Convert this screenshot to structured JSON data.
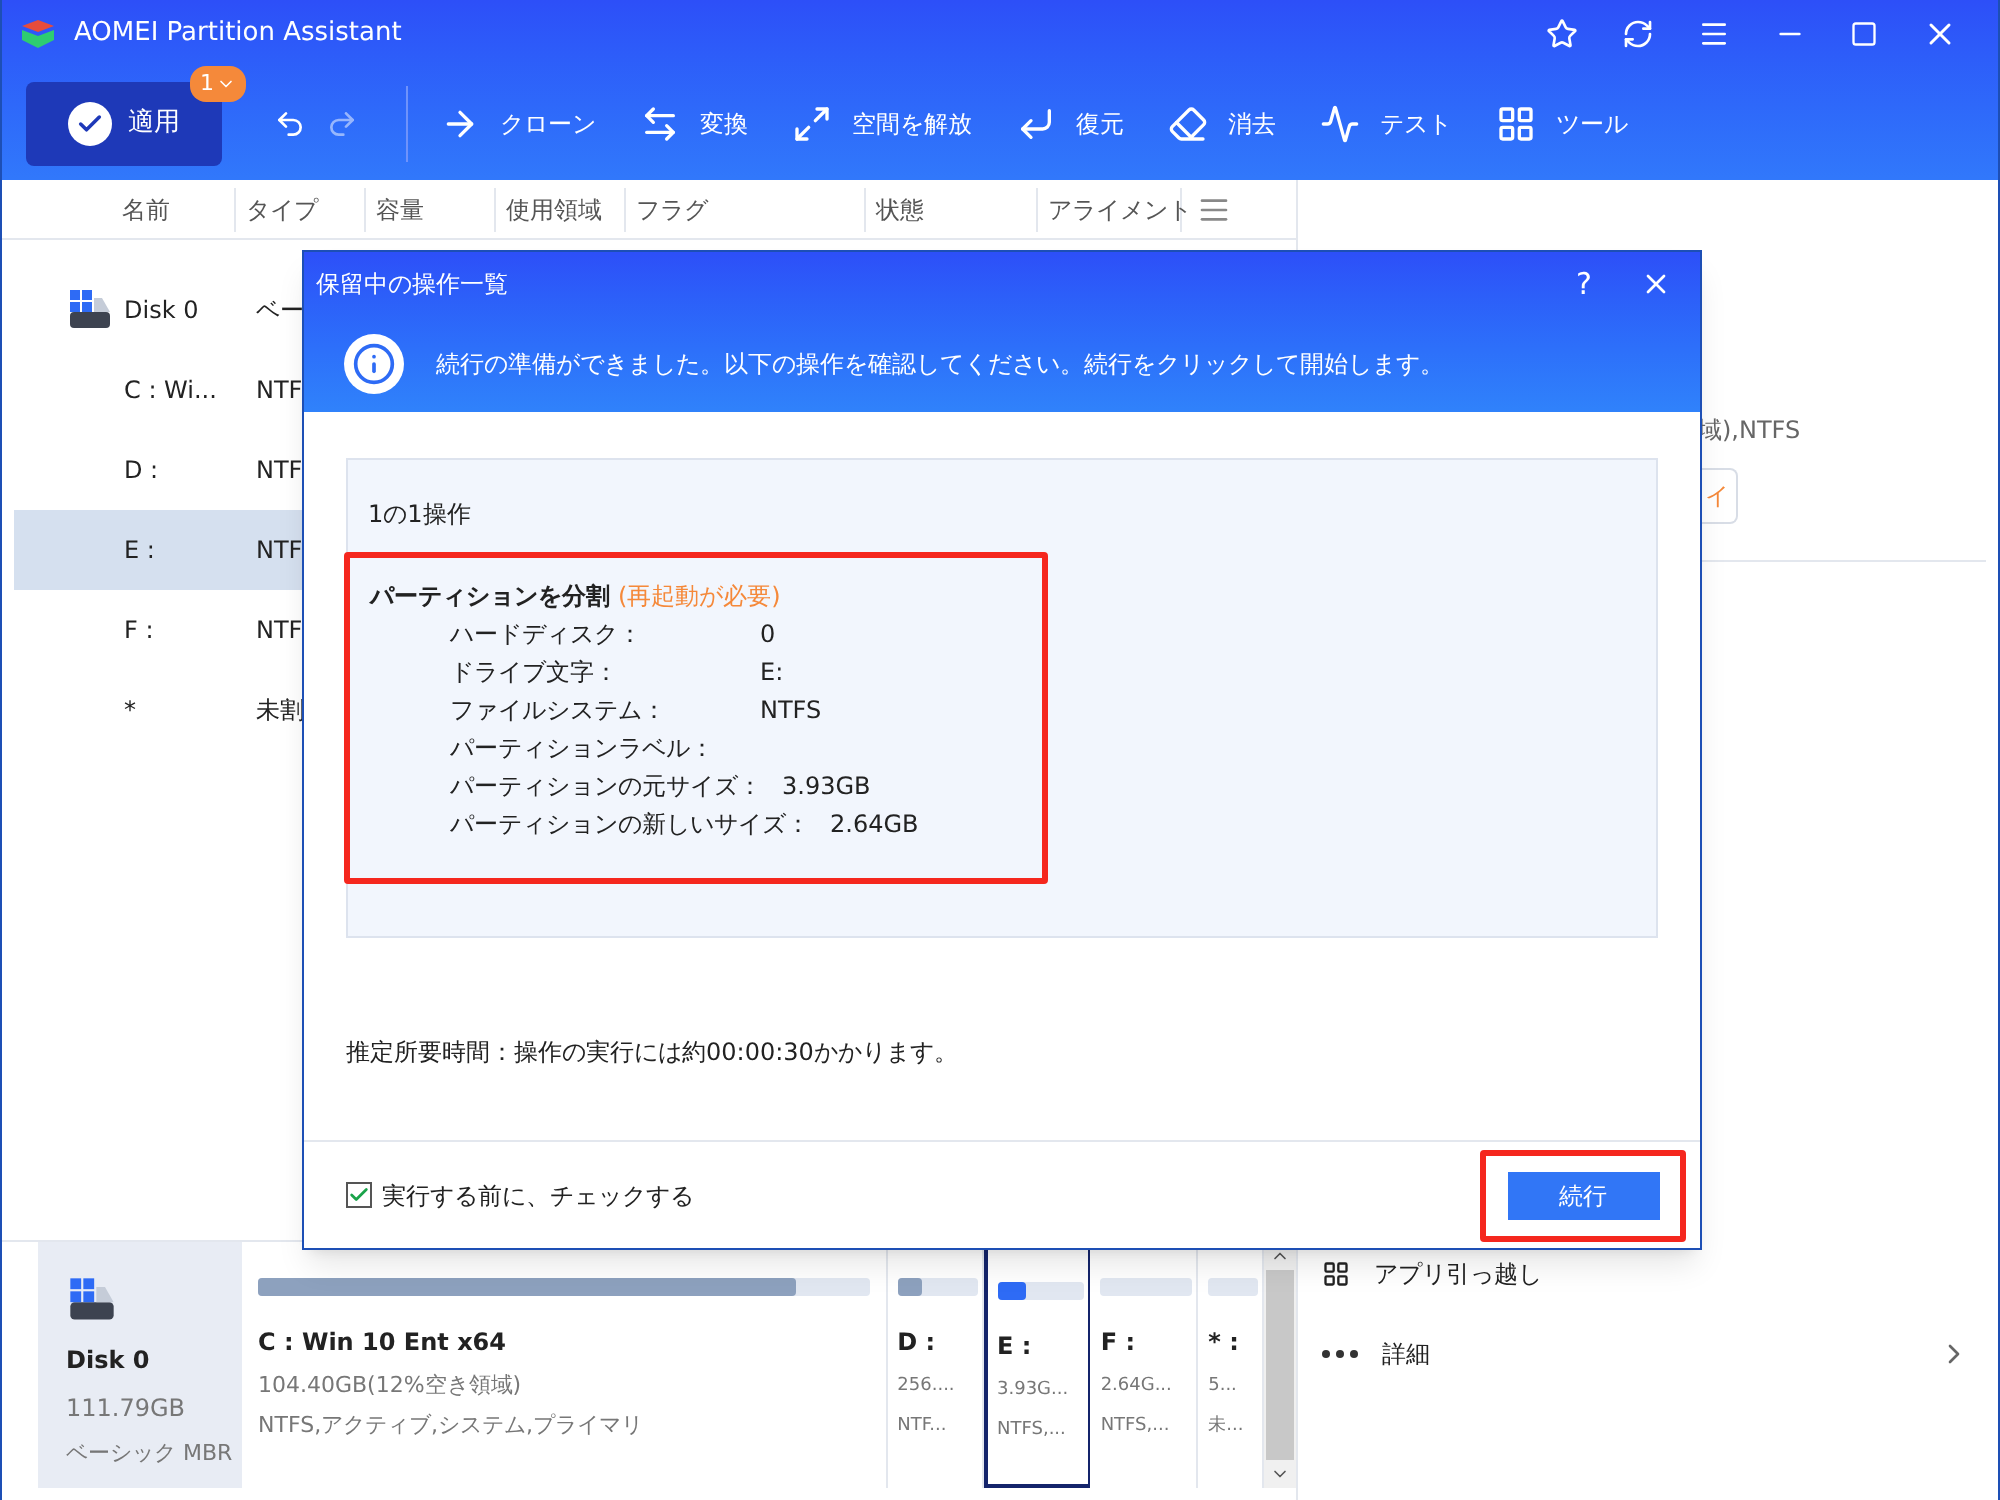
{
  "window": {
    "title": "AOMEI Partition Assistant"
  },
  "toolbar": {
    "apply": {
      "label": "適用",
      "badge": "1"
    },
    "tools": [
      {
        "label": "クローン",
        "kind": "clone"
      },
      {
        "label": "変換",
        "kind": "convert"
      },
      {
        "label": "空間を解放",
        "kind": "free"
      },
      {
        "label": "復元",
        "kind": "restore"
      },
      {
        "label": "消去",
        "kind": "wipe"
      },
      {
        "label": "テスト",
        "kind": "test"
      },
      {
        "label": "ツール",
        "kind": "tools"
      }
    ]
  },
  "columns": [
    "名前",
    "タイプ",
    "容量",
    "使用領域",
    "フラグ",
    "状態",
    "アライメント"
  ],
  "rows": [
    {
      "name": "Disk 0",
      "type": "ベー",
      "kind": "disk",
      "selected": false
    },
    {
      "name": "C : Wi...",
      "type": "NTF",
      "kind": "partition",
      "selected": false
    },
    {
      "name": "D :",
      "type": "NTF",
      "kind": "partition",
      "selected": false
    },
    {
      "name": "E :",
      "type": "NTF",
      "kind": "partition",
      "selected": true
    },
    {
      "name": "F :",
      "type": "NTF",
      "kind": "partition",
      "selected": false
    },
    {
      "name": "*",
      "type": "未割",
      "kind": "partition",
      "selected": false
    }
  ],
  "right_panel": {
    "fragment": "域),NTFS",
    "button_fragment": "イ",
    "items": [
      {
        "label": "アプリ引っ越し",
        "kind": "grid"
      },
      {
        "label": "詳細",
        "kind": "more"
      }
    ]
  },
  "disk_map": {
    "disk": {
      "name": "Disk 0",
      "size": "111.79GB",
      "type": "ベーシック MBR"
    },
    "partitions": [
      {
        "name": "C : Win 10 Ent x64",
        "size": "104.40GB(12%空き領域)",
        "info": "NTFS,アクティブ,システム,プライマリ",
        "level": 0.88,
        "selected": false
      },
      {
        "name": "D :",
        "size": "256....",
        "info": "NTF...",
        "level": 0.3,
        "selected": false
      },
      {
        "name": "E :",
        "size": "3.93G...",
        "info": "NTFS,...",
        "level": 0.33,
        "selected": true
      },
      {
        "name": "F :",
        "size": "2.64G...",
        "info": "NTFS,...",
        "selected": false
      },
      {
        "name": "* :",
        "size": "5...",
        "info": "未...",
        "selected": false
      }
    ]
  },
  "dialog": {
    "title": "保留中の操作一覧",
    "help": "?",
    "message": "続行の準備ができました。以下の操作を確認してください。続行をクリックして開始します。",
    "count": "1の1操作",
    "operation": {
      "title": "パーティションを分割",
      "note": "(再起動が必要)",
      "details": [
        {
          "label": "ハードディスク：",
          "value": "0"
        },
        {
          "label": "ドライブ文字：",
          "value": "E:"
        },
        {
          "label": "ファイルシステム：",
          "value": "NTFS"
        },
        {
          "label": "パーティションラベル："
        },
        {
          "label": "パーティションの元サイズ：",
          "value": "3.93GB"
        },
        {
          "label": "パーティションの新しいサイズ：",
          "value": "2.64GB"
        }
      ]
    },
    "estimate": "推定所要時間：操作の実行には約00:00:30かかります。",
    "checkbox": {
      "label": "実行する前に、チェックする",
      "checked": true
    },
    "button": "続行"
  }
}
